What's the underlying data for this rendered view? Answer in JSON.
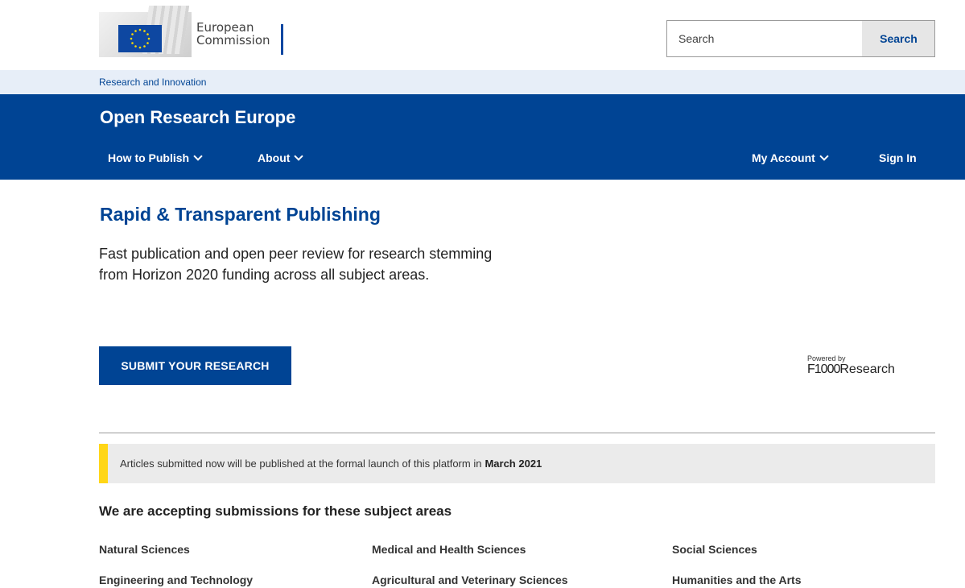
{
  "header": {
    "logo_line1": "European",
    "logo_line2": "Commission",
    "search_placeholder": "Search",
    "search_button": "Search"
  },
  "breadcrumb": {
    "label": "Research and Innovation"
  },
  "site": {
    "title": "Open Research Europe",
    "nav": [
      {
        "label": "How to Publish"
      },
      {
        "label": "About"
      }
    ],
    "account": "My Account",
    "signin": "Sign In"
  },
  "hero": {
    "title": "Rapid & Transparent Publishing",
    "text": "Fast publication and open peer review for research stemming from Horizon 2020 funding across all subject areas.",
    "submit_button": "SUBMIT YOUR RESEARCH",
    "powered_by": "Powered by",
    "powered_brand_a": "F1000",
    "powered_brand_b": "Research"
  },
  "notice": {
    "text": "Articles submitted now will be published at the formal launch of this platform in",
    "highlight": "March 2021"
  },
  "subjects": {
    "title": "We are accepting submissions for these subject areas",
    "items": [
      "Natural Sciences",
      "Medical and Health Sciences",
      "Social Sciences",
      "Engineering and Technology",
      "Agricultural and Veterinary Sciences",
      "Humanities and the Arts"
    ]
  },
  "colors": {
    "brand_blue": "#004494",
    "notice_accent": "#ffd617",
    "strip_bg": "#e7eef8"
  }
}
